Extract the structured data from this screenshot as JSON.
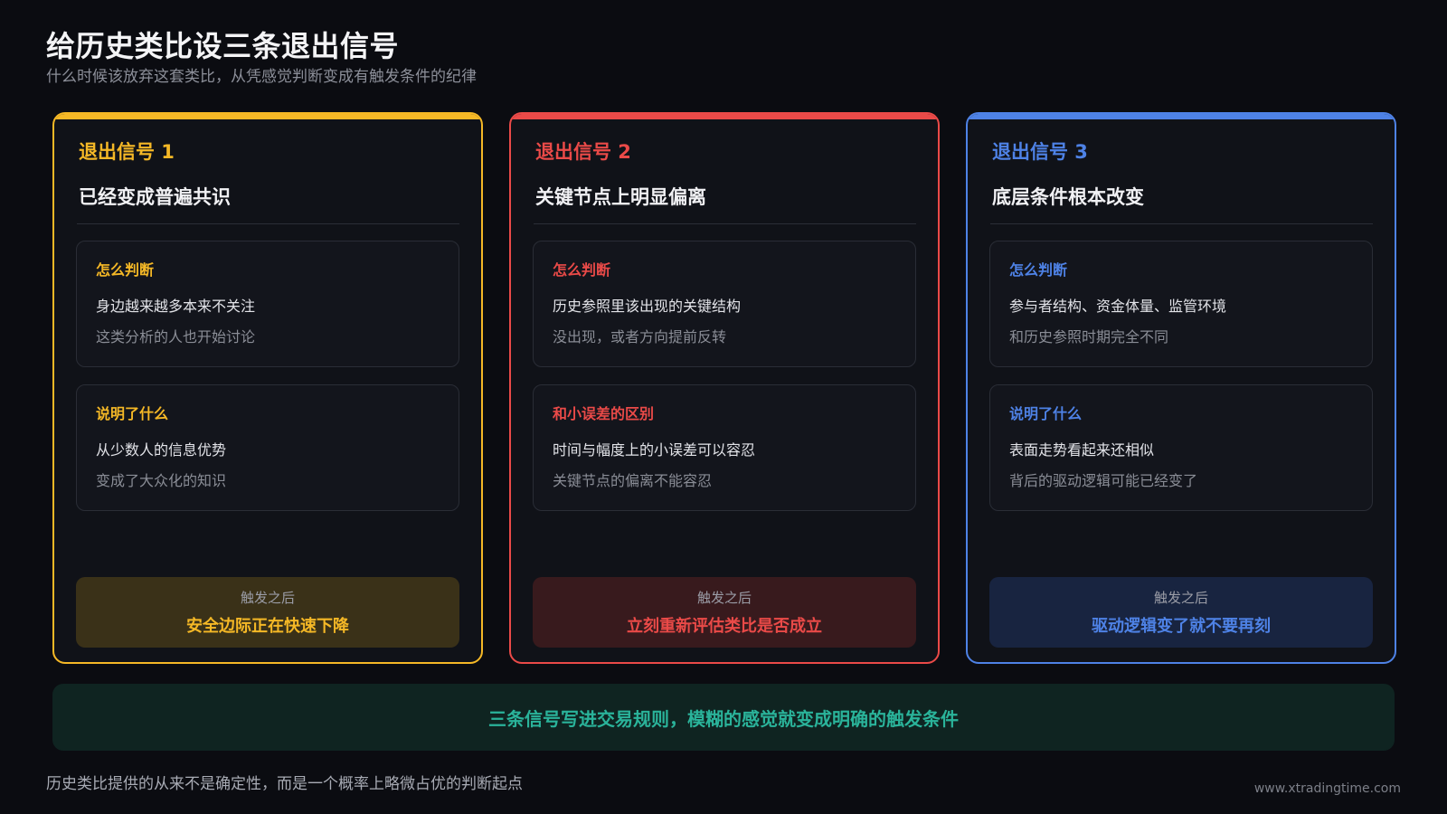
{
  "title": "给历史类比设三条退出信号",
  "subtitle": "什么时候该放弃这套类比，从凭感觉判断变成有触发条件的纪律",
  "colors": {
    "yellow": "#f5b826",
    "red": "#ea4a48",
    "blue": "#4e82e6",
    "teal": "#2ab39a"
  },
  "cards": [
    {
      "signal": "退出信号 1",
      "heading": "已经变成普遍共识",
      "box1": {
        "label": "怎么判断",
        "line1": "身边越来越多本来不关注",
        "line2": "这类分析的人也开始讨论"
      },
      "box2": {
        "label": "说明了什么",
        "line1": "从少数人的信息优势",
        "line2": "变成了大众化的知识"
      },
      "trigger_label": "触发之后",
      "trigger_value": "安全边际正在快速下降"
    },
    {
      "signal": "退出信号 2",
      "heading": "关键节点上明显偏离",
      "box1": {
        "label": "怎么判断",
        "line1": "历史参照里该出现的关键结构",
        "line2": "没出现，或者方向提前反转"
      },
      "box2": {
        "label": "和小误差的区别",
        "line1": "时间与幅度上的小误差可以容忍",
        "line2": "关键节点的偏离不能容忍"
      },
      "trigger_label": "触发之后",
      "trigger_value": "立刻重新评估类比是否成立"
    },
    {
      "signal": "退出信号 3",
      "heading": "底层条件根本改变",
      "box1": {
        "label": "怎么判断",
        "line1": "参与者结构、资金体量、监管环境",
        "line2": "和历史参照时期完全不同"
      },
      "box2": {
        "label": "说明了什么",
        "line1": "表面走势看起来还相似",
        "line2": "背后的驱动逻辑可能已经变了"
      },
      "trigger_label": "触发之后",
      "trigger_value": "驱动逻辑变了就不要再刻"
    }
  ],
  "banner": "三条信号写进交易规则，模糊的感觉就变成明确的触发条件",
  "footer": "历史类比提供的从来不是确定性，而是一个概率上略微占优的判断起点",
  "site": "www.xtradingtime.com"
}
